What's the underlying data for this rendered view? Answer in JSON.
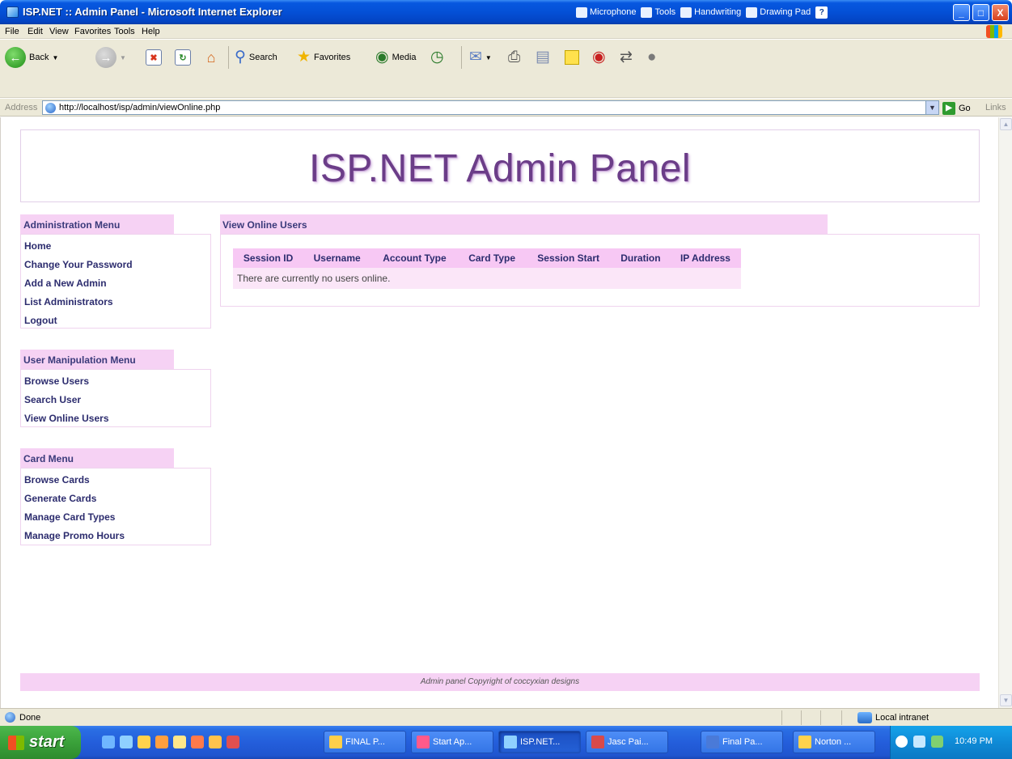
{
  "window": {
    "title": "ISP.NET :: Admin Panel - Microsoft Internet Explorer",
    "language_bar": [
      "Microphone",
      "Tools",
      "Handwriting",
      "Drawing Pad"
    ],
    "language_bar_help": "?",
    "min_symbol": "_",
    "max_symbol": "□",
    "close_symbol": "X"
  },
  "menubar": {
    "items": [
      "File",
      "Edit",
      "View",
      "Favorites",
      "Tools",
      "Help"
    ]
  },
  "toolbar": {
    "back_label": "Back",
    "search_label": "Search",
    "favorites_label": "Favorites",
    "media_label": "Media"
  },
  "address": {
    "label": "Address",
    "url": "http://localhost/isp/admin/viewOnline.php",
    "go_label": "Go",
    "links_label": "Links"
  },
  "page": {
    "site_title": "ISP.NET Admin Panel",
    "admin_menu": {
      "heading": "Administration Menu",
      "items": [
        "Home",
        "Change Your Password",
        "Add a New Admin",
        "List Administrators",
        "Logout"
      ]
    },
    "user_menu": {
      "heading": "User Manipulation Menu",
      "items": [
        "Browse Users",
        "Search User",
        "View Online Users"
      ]
    },
    "card_menu": {
      "heading": "Card Menu",
      "items": [
        "Browse Cards",
        "Generate Cards",
        "Manage Card Types",
        "Manage Promo Hours"
      ]
    },
    "main_panel": {
      "heading": "View Online Users",
      "columns": [
        "Session ID",
        "Username",
        "Account Type",
        "Card Type",
        "Session Start",
        "Duration",
        "IP Address"
      ],
      "empty_message": "There are currently no users online."
    },
    "footer": "Admin panel Copyright of coccyxian designs"
  },
  "statusbar": {
    "text": "Done",
    "zone": "Local intranet"
  },
  "taskbar": {
    "start_label": "start",
    "tasks": [
      "FINAL P...",
      "Start Ap...",
      "ISP.NET...",
      "Jasc Pai...",
      "Final Pa...",
      "Norton ..."
    ],
    "active_task": 2,
    "clock": "10:49 PM"
  },
  "colors": {
    "menu_header_bg": "#f6d2f4",
    "menu_link": "#2c2c6e",
    "title_color": "#6b3d88",
    "xp_blue": "#0450d6"
  }
}
